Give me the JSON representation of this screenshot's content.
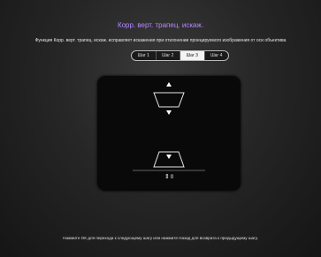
{
  "header": {
    "title": "Корр. верт. трапец. искаж.",
    "description": "Функция Корр. верт. трапец. искаж. исправляет искажения при отклонении проецируемого изображения от оси объектива"
  },
  "steps": [
    {
      "label": "Шаг 1",
      "active": false
    },
    {
      "label": "Шаг 2",
      "active": false
    },
    {
      "label": "Шаг 3",
      "active": true
    },
    {
      "label": "Шаг 4",
      "active": false
    }
  ],
  "adjustment": {
    "value": "0",
    "icon": "up-down-arrows-icon"
  },
  "footer": {
    "hint": "Нажмите ОК для перехода к следующему шагу или нажмите Назад для возврата к предыдущему шагу."
  },
  "colors": {
    "title": "#b388ff",
    "background": "#262626",
    "panel": "#090909",
    "active_step": "#f4f4f4"
  }
}
